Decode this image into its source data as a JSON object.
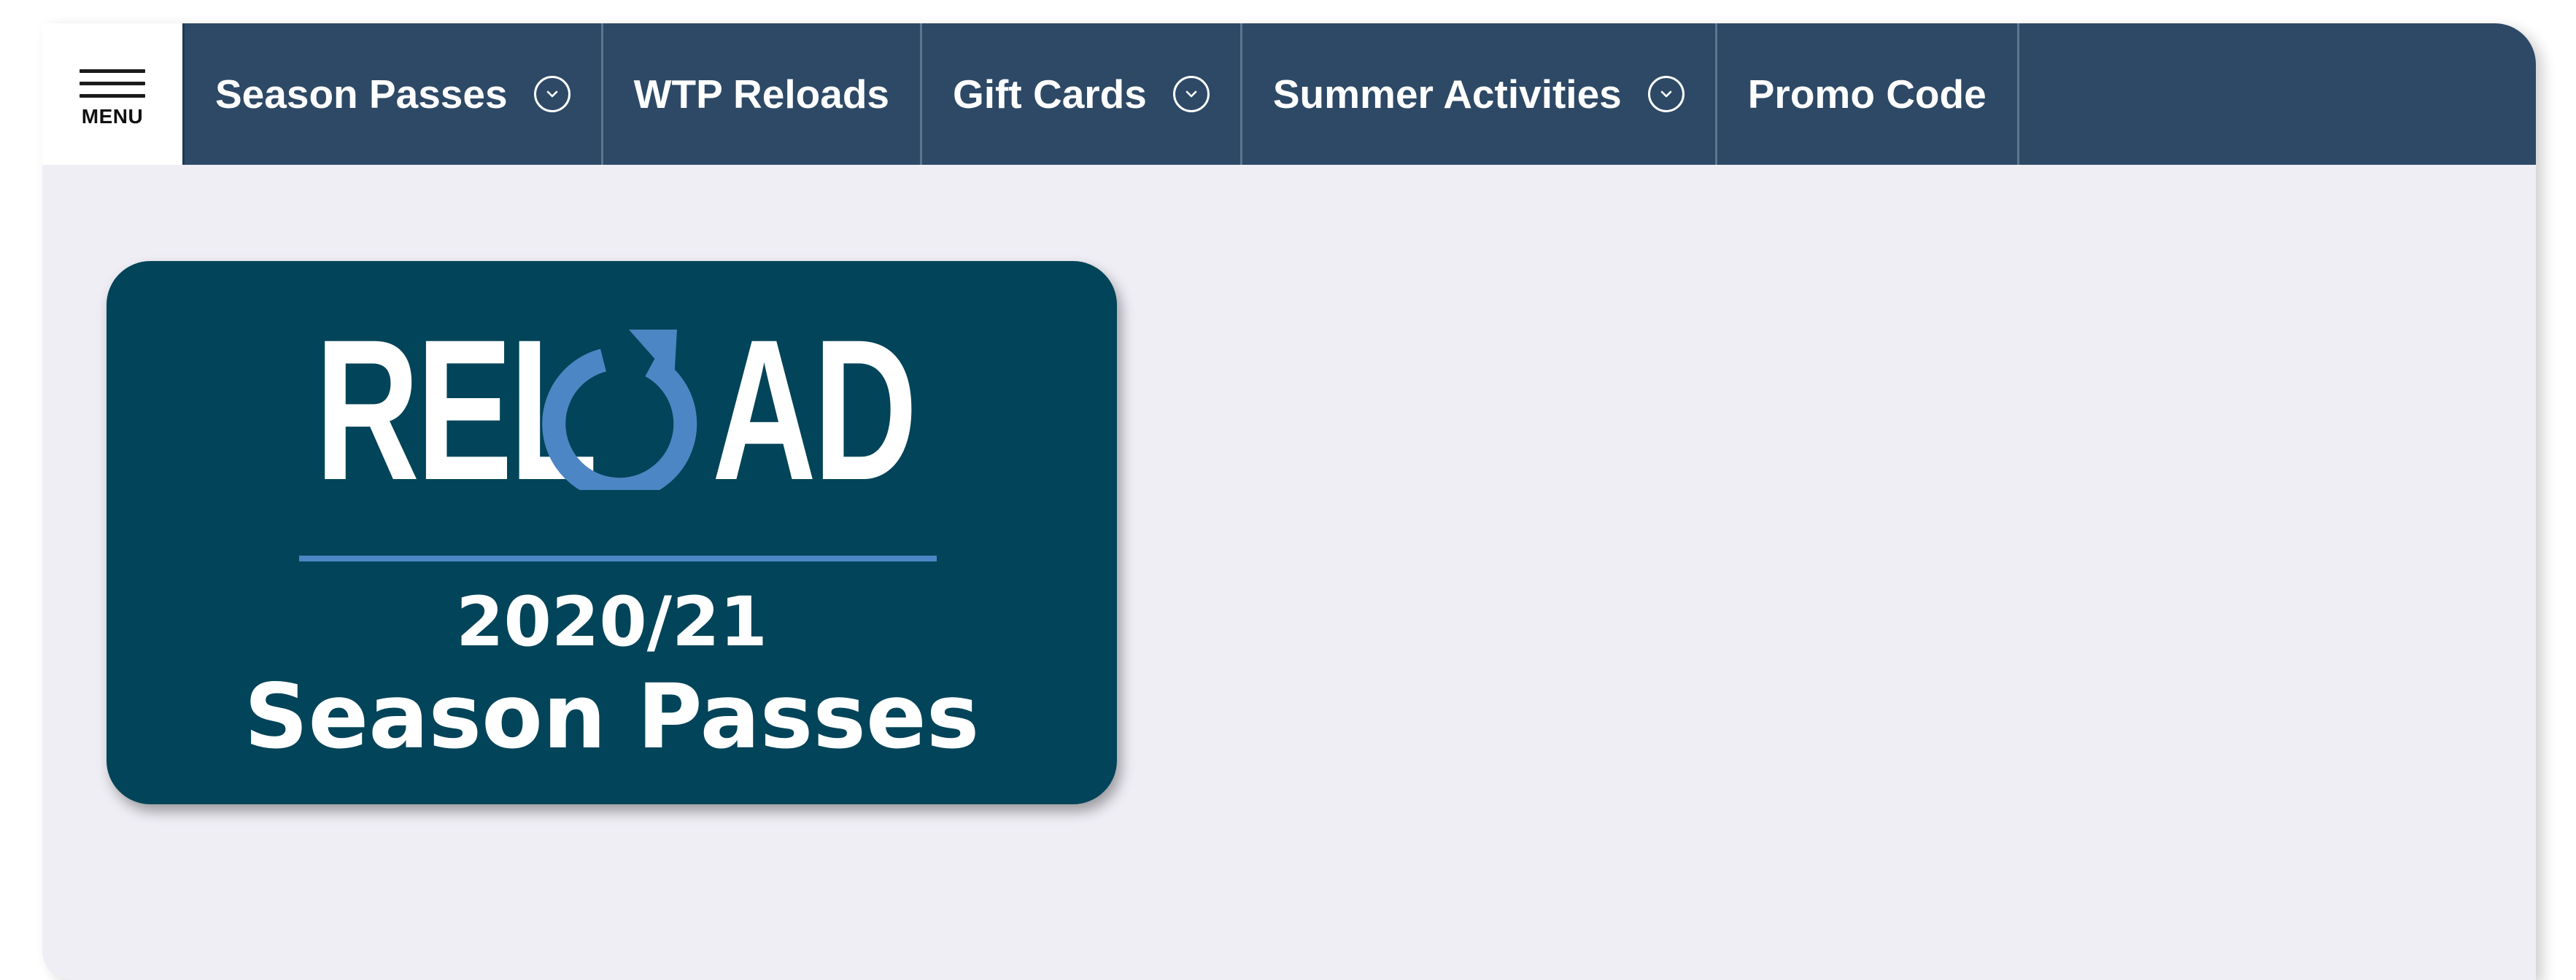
{
  "menu": {
    "label": "MENU",
    "icon": "hamburger-icon"
  },
  "nav": {
    "items": [
      {
        "label": "Season Passes",
        "has_dropdown": true
      },
      {
        "label": "WTP Reloads",
        "has_dropdown": false
      },
      {
        "label": "Gift Cards",
        "has_dropdown": true
      },
      {
        "label": "Summer Activities",
        "has_dropdown": true
      },
      {
        "label": "Promo Code",
        "has_dropdown": false
      }
    ],
    "dropdown_icon": "chevron-down-circle-icon"
  },
  "banner": {
    "word_left": "REL",
    "word_right": "AD",
    "icon": "reload-arrow-icon",
    "year": "2020/21",
    "subtitle": "Season Passes"
  },
  "colors": {
    "nav_bg": "#2d4966",
    "page_bg": "#efeef5",
    "banner_bg": "#024459",
    "accent_blue": "#4d86c4"
  }
}
